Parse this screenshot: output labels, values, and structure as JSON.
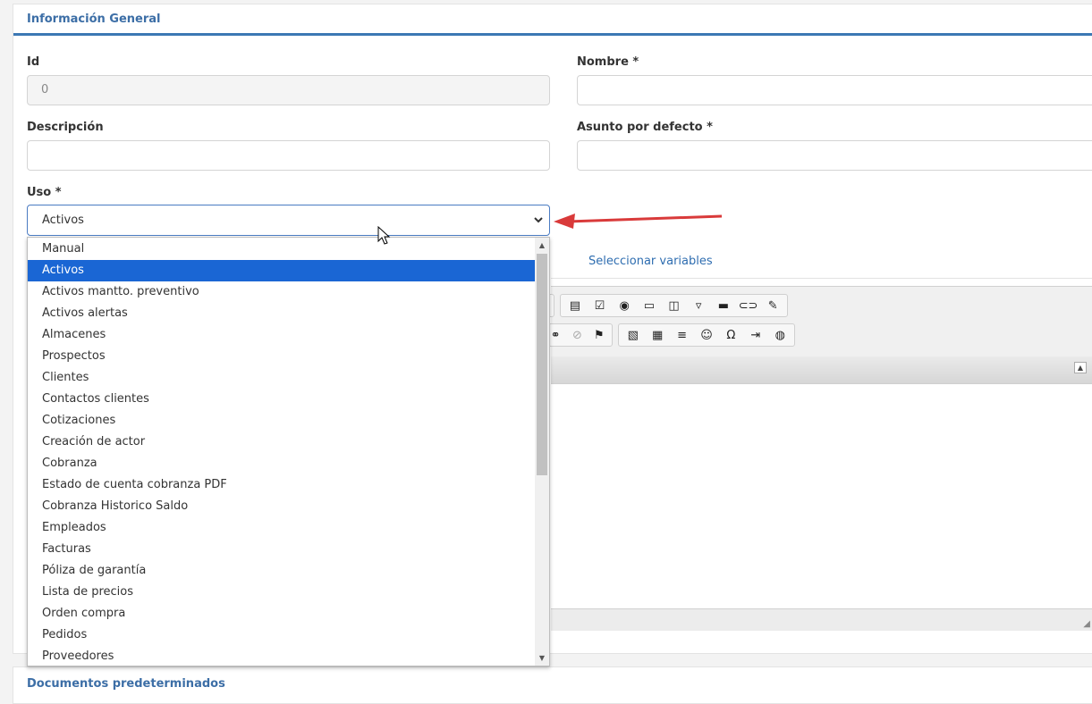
{
  "panel": {
    "title": "Información General"
  },
  "fields": {
    "id": {
      "label": "Id",
      "value": "0"
    },
    "nombre": {
      "label": "Nombre *",
      "value": ""
    },
    "descripcion": {
      "label": "Descripción",
      "value": ""
    },
    "asunto": {
      "label": "Asunto por defecto *",
      "value": ""
    },
    "uso": {
      "label": "Uso *",
      "value": "Activos"
    }
  },
  "dropdown": {
    "selected_index": 1,
    "options": [
      "Manual",
      "Activos",
      "Activos mantto. preventivo",
      "Activos alertas",
      "Almacenes",
      "Prospectos",
      "Clientes",
      "Contactos clientes",
      "Cotizaciones",
      "Creación de actor",
      "Cobranza",
      "Estado de cuenta cobranza PDF",
      "Cobranza Historico Saldo",
      "Empleados",
      "Facturas",
      "Póliza de garantía",
      "Lista de precios",
      "Orden compra",
      "Pedidos",
      "Proveedores"
    ]
  },
  "tabs": {
    "variables": "Seleccionar variables"
  },
  "editor": {
    "toolbar_row1": [
      "form-icon",
      "checkbox-icon",
      "radio-icon",
      "textfield-icon",
      "textarea-icon",
      "select-icon",
      "button-icon",
      "image-button-icon",
      "hidden-field-icon"
    ],
    "toolbar_row2a": [
      "anchor-icon",
      "unlink-icon",
      "flag-icon"
    ],
    "toolbar_row2b": [
      "image-icon",
      "table-icon",
      "horizontal-rule-icon",
      "smiley-icon",
      "omega-icon",
      "pagebreak-icon",
      "iframe-icon"
    ]
  },
  "panel2": {
    "title": "Documentos predeterminados"
  },
  "colors": {
    "accent": "#3c78b4",
    "selection": "#1a66d4",
    "arrow": "#d93a3a"
  }
}
